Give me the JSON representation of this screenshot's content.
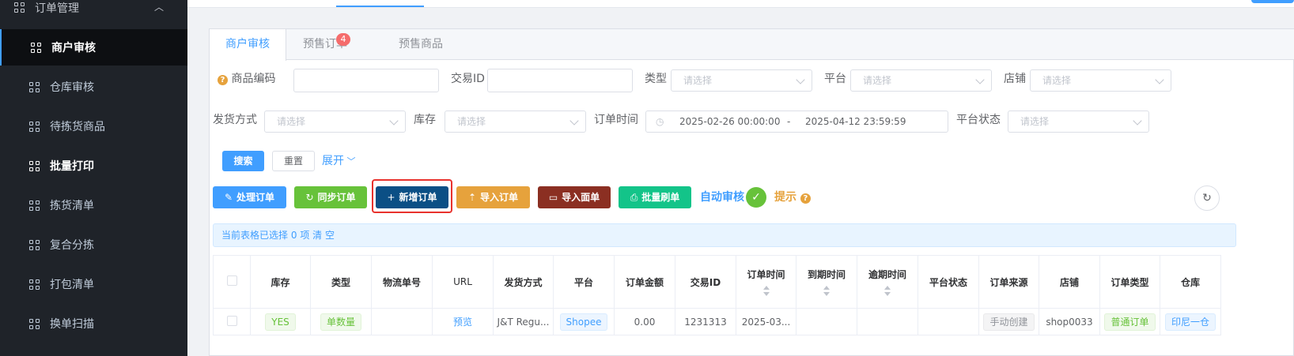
{
  "sidebar": {
    "group_label": "订单管理",
    "items": [
      {
        "label": "商户审核"
      },
      {
        "label": "仓库审核"
      },
      {
        "label": "待拣货商品"
      },
      {
        "label": "批量打印"
      },
      {
        "label": "拣货清单"
      },
      {
        "label": "复合分拣"
      },
      {
        "label": "打包清单"
      },
      {
        "label": "换单扫描"
      }
    ]
  },
  "tabs": [
    {
      "label": "商户审核"
    },
    {
      "label": "预售订单",
      "badge": "4"
    },
    {
      "label": "预售商品"
    }
  ],
  "filters": {
    "product_code_label": "商品编码",
    "trade_id_label": "交易ID",
    "type_label": "类型",
    "platform_label": "平台",
    "store_label": "店铺",
    "ship_method_label": "发货方式",
    "stock_label": "库存",
    "order_time_label": "订单时间",
    "platform_status_label": "平台状态",
    "select_placeholder": "请选择",
    "date_start": "2025-02-26 00:00:00",
    "date_sep": "-",
    "date_end": "2025-04-12 23:59:59",
    "search_btn": "搜索",
    "reset_btn": "重置",
    "expand_link": "展开"
  },
  "actions": {
    "process_order": "处理订单",
    "sync_order": "同步订单",
    "add_order": "新增订单",
    "import_order": "导入订单",
    "import_waybill": "导入面单",
    "batch_refresh": "批量刷单",
    "auto_review": "自动审核",
    "hint": "提示"
  },
  "selection": {
    "prefix": "当前表格已选择",
    "count": "0",
    "unit": "项",
    "clear": "清 空"
  },
  "table": {
    "headers": [
      "库存",
      "类型",
      "物流单号",
      "URL",
      "发货方式",
      "平台",
      "订单金额",
      "交易ID",
      "订单时间",
      "到期时间",
      "逾期时间",
      "平台状态",
      "订单来源",
      "店铺",
      "订单类型",
      "仓库"
    ],
    "rows": [
      {
        "stock": "YES",
        "type": "单数量",
        "tracking": "",
        "url": "预览",
        "ship": "J&T Regu...",
        "platform": "Shopee",
        "amount": "0.00",
        "trade_id": "1231313",
        "order_time": "2025-03...",
        "due": "",
        "overdue": "",
        "status": "",
        "source": "手动创建",
        "store": "shop0033",
        "order_type": "普通订单",
        "warehouse": "印尼一仓"
      }
    ]
  },
  "colors": {
    "primary": "#409eff",
    "success": "#67c23a",
    "warning": "#e6a23c",
    "dark_blue": "#0b4f85",
    "brown": "#8b2f22",
    "teal": "#13c489",
    "highlight_border": "#e8322d"
  }
}
